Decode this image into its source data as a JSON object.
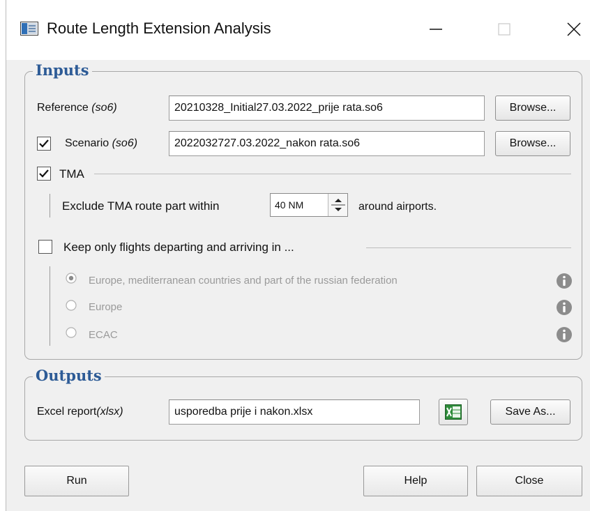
{
  "window": {
    "title": "Route Length Extension Analysis",
    "minimize_glyph": "—",
    "close_glyph": "✕"
  },
  "inputs": {
    "group_title": "Inputs",
    "reference": {
      "label": "Reference ",
      "label_format": "(so6)",
      "value": "20210328_Initial27.03.2022_prije rata.so6",
      "browse_label": "Browse..."
    },
    "scenario": {
      "checked": true,
      "label": "Scenario ",
      "label_format": "(so6)",
      "value": "2022032727.03.2022_nakon rata.so6",
      "browse_label": "Browse..."
    },
    "tma": {
      "checked": true,
      "label": "TMA",
      "exclude_label": "Exclude TMA route part within",
      "distance_value": "40 NM",
      "suffix_label": "around airports."
    },
    "keep_flights": {
      "checked": false,
      "label": "Keep only flights departing and arriving in ...",
      "options": [
        {
          "label": "Europe, mediterranean countries and part of the russian federation",
          "selected": true,
          "info_icon": "info-icon"
        },
        {
          "label": "Europe",
          "selected": false,
          "info_icon": "info-icon"
        },
        {
          "label": "ECAC",
          "selected": false,
          "info_icon": "info-icon"
        }
      ]
    }
  },
  "outputs": {
    "group_title": "Outputs",
    "excel": {
      "label": "Excel report",
      "label_format": "(xlsx)",
      "value": "usporedba prije i nakon.xlsx",
      "icon": "excel-icon",
      "save_as_label": "Save As..."
    }
  },
  "footer": {
    "run_label": "Run",
    "help_label": "Help",
    "close_label": "Close"
  },
  "colors": {
    "group_title": "#2d5b96",
    "dialog_bg": "#f0f0f0",
    "disabled_text": "#9a9a9a"
  }
}
